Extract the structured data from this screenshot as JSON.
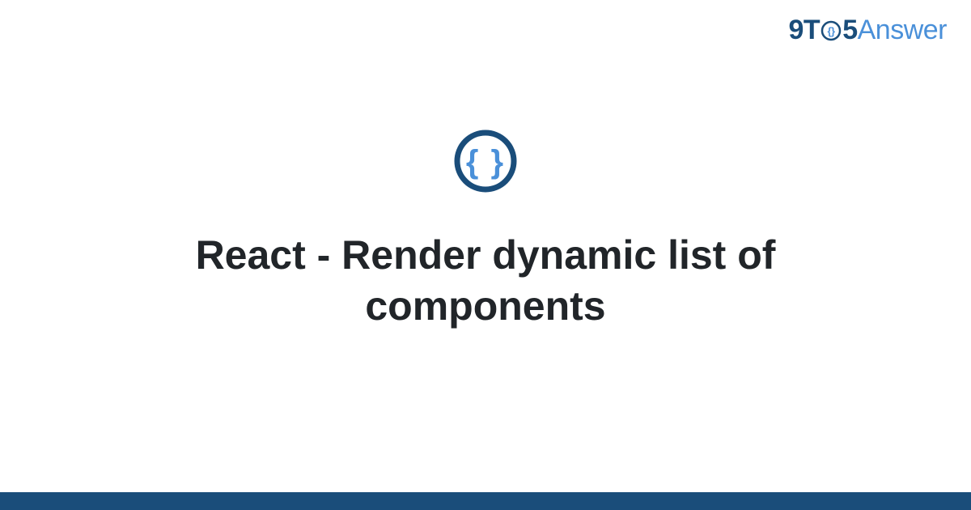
{
  "logo": {
    "part1": "9T",
    "part2": "5",
    "part3": "Answer"
  },
  "icon": {
    "name": "braces-icon",
    "glyph": "{ }"
  },
  "title": "React - Render dynamic list of components",
  "colors": {
    "primary_dark": "#1a4d7a",
    "primary_light": "#4a90d9",
    "text": "#212529"
  }
}
